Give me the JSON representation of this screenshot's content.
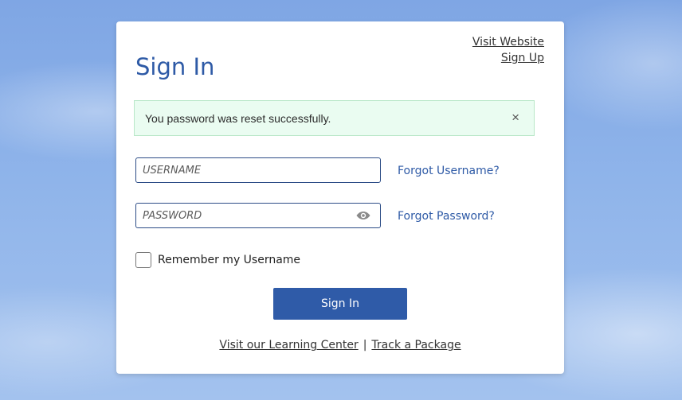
{
  "header": {
    "visit_website": "Visit Website",
    "sign_up": "Sign Up",
    "title": "Sign In"
  },
  "alert": {
    "message": "You password was reset successfully.",
    "close_glyph": "×"
  },
  "form": {
    "username_placeholder": "USERNAME",
    "password_placeholder": "PASSWORD",
    "forgot_username": "Forgot Username?",
    "forgot_password": "Forgot Password?",
    "remember_label": "Remember my Username",
    "remember_checked": false,
    "submit_label": "Sign In"
  },
  "footer": {
    "learning_center": "Visit our Learning Center",
    "separator": "|",
    "track_package": "Track a Package"
  },
  "colors": {
    "brand_blue": "#2f5ba8",
    "title_blue": "#2e5aa6",
    "alert_bg": "#eafcf1",
    "alert_border": "#b9e7c8"
  },
  "icons": {
    "close": "close-icon",
    "password_visibility": "eye-icon"
  }
}
